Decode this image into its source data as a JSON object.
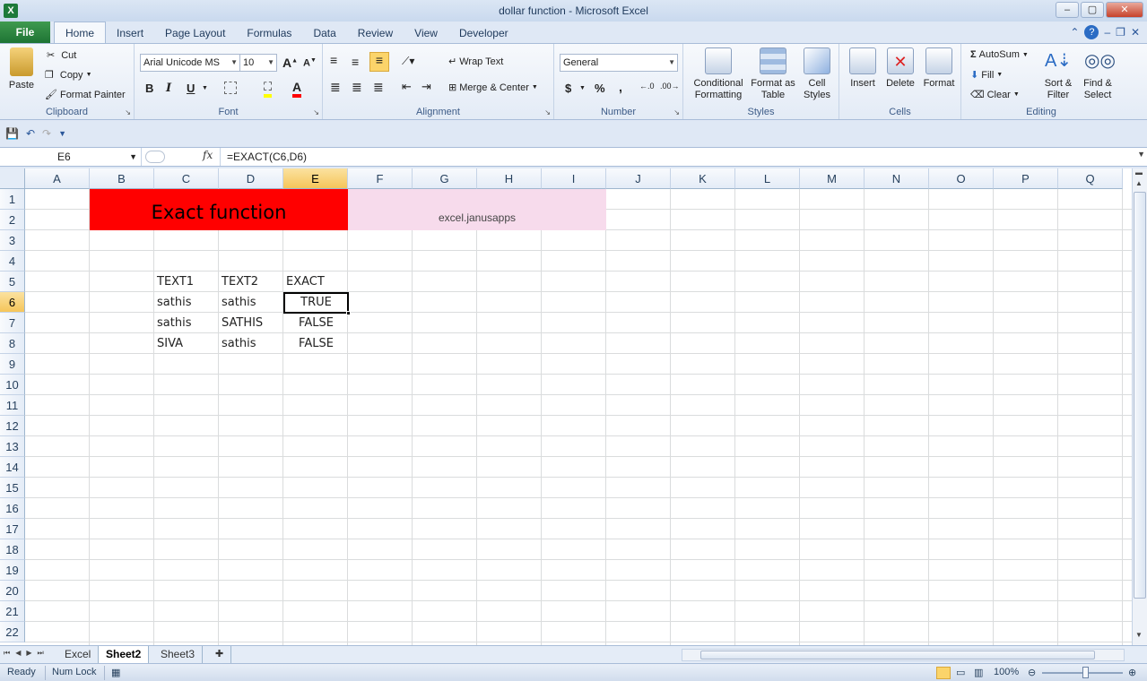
{
  "window": {
    "title": "dollar function  -  Microsoft Excel",
    "min_label": "–",
    "max_label": "▢",
    "close_label": "✕"
  },
  "tabs": {
    "file": "File",
    "items": [
      "Home",
      "Insert",
      "Page Layout",
      "Formulas",
      "Data",
      "Review",
      "View",
      "Developer"
    ],
    "active": "Home"
  },
  "ribbon": {
    "clipboard": {
      "label": "Clipboard",
      "paste": "Paste",
      "cut": "Cut",
      "copy": "Copy",
      "format_painter": "Format Painter"
    },
    "font": {
      "label": "Font",
      "name": "Arial Unicode MS",
      "size": "10",
      "bold": "B",
      "italic": "I",
      "underline": "U"
    },
    "alignment": {
      "label": "Alignment",
      "wrap_text": "Wrap Text",
      "merge_center": "Merge & Center"
    },
    "number": {
      "label": "Number",
      "format": "General",
      "currency": "$",
      "percent": "%",
      "comma": ","
    },
    "styles": {
      "label": "Styles",
      "conditional": "Conditional Formatting",
      "format_table": "Format as Table",
      "cell_styles": "Cell Styles"
    },
    "cells": {
      "label": "Cells",
      "insert": "Insert",
      "delete": "Delete",
      "format": "Format"
    },
    "editing": {
      "label": "Editing",
      "autosum": "AutoSum",
      "fill": "Fill",
      "clear": "Clear",
      "sort_filter": "Sort & Filter",
      "find_select": "Find & Select"
    }
  },
  "formula_bar": {
    "name_box": "E6",
    "fx": "fx",
    "formula": "=EXACT(C6,D6)"
  },
  "grid": {
    "columns": [
      "A",
      "B",
      "C",
      "D",
      "E",
      "F",
      "G",
      "H",
      "I",
      "J",
      "K",
      "L",
      "M",
      "N",
      "O",
      "P",
      "Q"
    ],
    "rows": [
      "1",
      "2",
      "3",
      "4",
      "5",
      "6",
      "7",
      "8",
      "9",
      "10",
      "11",
      "12",
      "13",
      "14",
      "15",
      "16",
      "17",
      "18",
      "19",
      "20",
      "21",
      "22"
    ],
    "selected_col": "E",
    "selected_row": "6",
    "banner_title": "Exact function",
    "banner_site": "excel.janusapps",
    "headers": {
      "c": "TEXT1",
      "d": "TEXT2",
      "e": "EXACT"
    },
    "data": [
      {
        "c": "sathis",
        "d": "sathis",
        "e": "TRUE"
      },
      {
        "c": "sathis",
        "d": "SATHIS",
        "e": "FALSE"
      },
      {
        "c": "SIVA",
        "d": "sathis",
        "e": "FALSE"
      }
    ]
  },
  "sheets": {
    "items": [
      "Excel",
      "Sheet2",
      "Sheet3"
    ],
    "active": "Sheet2"
  },
  "status": {
    "ready": "Ready",
    "numlock": "Num Lock",
    "zoom": "100%"
  },
  "colors": {
    "banner_red": "#ff0000",
    "banner_pink": "#f7dbec",
    "selected_header": "#f5c55a"
  }
}
